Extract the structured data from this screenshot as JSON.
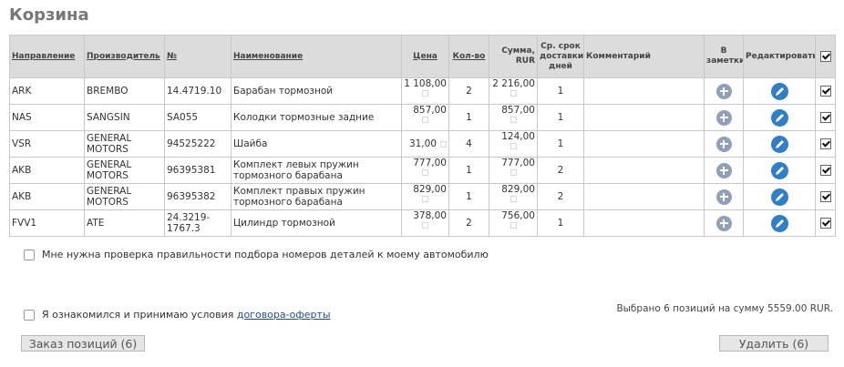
{
  "title": "Корзина",
  "columns": {
    "direction": "Направление",
    "maker": "Производитель",
    "number": "№",
    "name": "Наименование",
    "price": "Цена",
    "qty": "Кол-во",
    "sum": "Сумма, RUR",
    "delivery": "Ср. срок доставки, дней",
    "comment": "Комментарий",
    "notes": "В заметки",
    "edit": "Редактировать"
  },
  "rows": [
    {
      "direction": "ARK",
      "maker": "BREMBO",
      "number": "14.4719.10",
      "name": "Барабан тормозной",
      "price": "1 108,00",
      "qty": "2",
      "sum": "2 216,00",
      "delivery": "1",
      "checked": true
    },
    {
      "direction": "NAS",
      "maker": "SANGSIN",
      "number": "SA055",
      "name": "Колодки тормозные задние",
      "price": "857,00",
      "qty": "1",
      "sum": "857,00",
      "delivery": "1",
      "checked": true
    },
    {
      "direction": "VSR",
      "maker": "GENERAL MOTORS",
      "number": "94525222",
      "name": "Шайба",
      "price": "31,00",
      "qty": "4",
      "sum": "124,00",
      "delivery": "1",
      "checked": true
    },
    {
      "direction": "AKB",
      "maker": "GENERAL MOTORS",
      "number": "96395381",
      "name": "Комплект левых пружин тормозного барабана",
      "price": "777,00",
      "qty": "1",
      "sum": "777,00",
      "delivery": "2",
      "checked": true
    },
    {
      "direction": "AKB",
      "maker": "GENERAL MOTORS",
      "number": "96395382",
      "name": "Комплект правых пружин тормозного барабана",
      "price": "829,00",
      "qty": "1",
      "sum": "829,00",
      "delivery": "2",
      "checked": true
    },
    {
      "direction": "FVV1",
      "maker": "ATE",
      "number": "24.3219-1767.3",
      "name": "Цилиндр тормозной",
      "price": "378,00",
      "qty": "2",
      "sum": "756,00",
      "delivery": "1",
      "checked": true
    }
  ],
  "options": {
    "verify_label": "Мне нужна проверка правильности подбора номеров деталей к моему автомобилю",
    "accept_label": "Я ознакомился и принимаю условия",
    "accept_link": "договора-оферты"
  },
  "summary": "Выбрано 6 позиций на сумму 5559.00 RUR.",
  "buttons": {
    "order": "Заказ позиций (6)",
    "delete": "Удалить (6)"
  },
  "colors": {
    "header_bg": "#dcdcdc",
    "plus_icon": "#8fa0b8",
    "edit_icon": "#2f7fc8",
    "link": "#1a4f9a"
  }
}
